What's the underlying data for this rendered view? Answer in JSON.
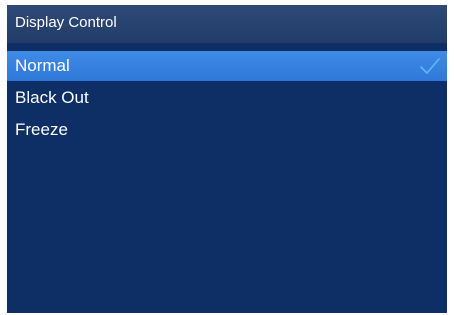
{
  "window": {
    "title": "Display Control"
  },
  "menu": {
    "items": [
      {
        "label": "Normal",
        "selected": true,
        "checked": true
      },
      {
        "label": "Black Out",
        "selected": false,
        "checked": false
      },
      {
        "label": "Freeze",
        "selected": false,
        "checked": false
      }
    ]
  },
  "icons": {
    "check": "checkmark-icon"
  },
  "colors": {
    "background": "#0d2f66",
    "title_bar": "#223c69",
    "selection": "#3484de",
    "check": "#5db6ff",
    "text": "#ffffff"
  }
}
